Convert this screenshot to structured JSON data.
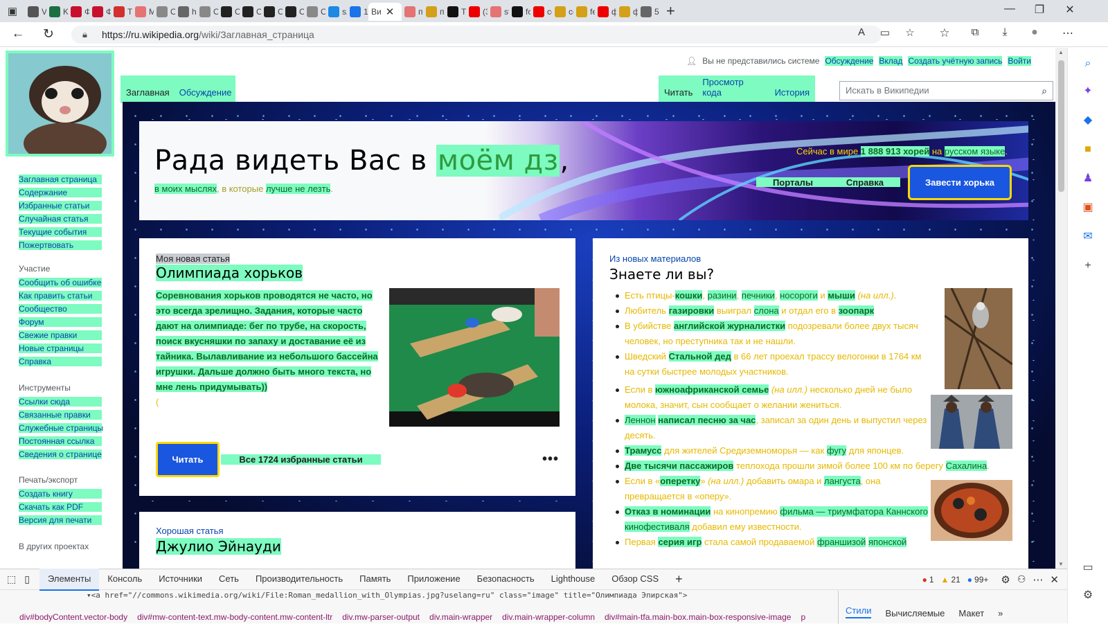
{
  "browser": {
    "tabs": [
      {
        "title": "Vi",
        "color": "#555"
      },
      {
        "title": "Ki",
        "color": "#1d6f42"
      },
      {
        "title": "Ф",
        "color": "#c8102e"
      },
      {
        "title": "Ф",
        "color": "#c8102e"
      },
      {
        "title": "Тс",
        "color": "#d32f2f"
      },
      {
        "title": "М",
        "color": "#e57373"
      },
      {
        "title": "О",
        "color": "#888"
      },
      {
        "title": "h",
        "color": "#666"
      },
      {
        "title": "О",
        "color": "#888"
      },
      {
        "title": "О",
        "color": "#222"
      },
      {
        "title": "О",
        "color": "#222"
      },
      {
        "title": "О",
        "color": "#222"
      },
      {
        "title": "О",
        "color": "#222"
      },
      {
        "title": "О",
        "color": "#888"
      },
      {
        "title": "sz",
        "color": "#1e88e5"
      },
      {
        "title": "1",
        "color": "#1a73e8"
      }
    ],
    "active_tab_title": "Ви",
    "tabs_after": [
      {
        "title": "п",
        "color": "#e57373"
      },
      {
        "title": "п",
        "color": "#d4a017"
      },
      {
        "title": "Те",
        "color": "#111"
      },
      {
        "title": "(3",
        "color": "#e00"
      },
      {
        "title": "st",
        "color": "#e57373"
      },
      {
        "title": "fc",
        "color": "#111"
      },
      {
        "title": "cc",
        "color": "#e00"
      },
      {
        "title": "cc",
        "color": "#d4a017"
      },
      {
        "title": "fe",
        "color": "#d4a017"
      },
      {
        "title": "ф",
        "color": "#e00"
      },
      {
        "title": "ф",
        "color": "#d4a017"
      },
      {
        "title": "5",
        "color": "#666"
      }
    ],
    "url_host": "https://ru.wikipedia.org",
    "url_path": "/wiki/Заглавная_страница"
  },
  "wiki": {
    "personal": {
      "not_logged": "Вы не представились системе",
      "links": [
        "Обсуждение",
        "Вклад",
        "Создать учётную запись",
        "Войти"
      ]
    },
    "left_tabs": [
      "Заглавная",
      "Обсуждение"
    ],
    "right_tabs": [
      "Читать",
      "Просмотр кода",
      "История"
    ],
    "search_placeholder": "Искать в Википедии",
    "sidebar": {
      "nav": [
        "Заглавная страница",
        "Содержание",
        "Избранные статьи",
        "Случайная статья",
        "Текущие события",
        "Пожертвовать"
      ],
      "participation_head": "Участие",
      "participation": [
        "Сообщить об ошибке",
        "Как править статьи",
        "Сообщество",
        "Форум",
        "Свежие правки",
        "Новые страницы",
        "Справка"
      ],
      "tools_head": "Инструменты",
      "tools": [
        "Ссылки сюда",
        "Связанные правки",
        "Служебные страницы",
        "Постоянная ссылка",
        "Сведения о странице"
      ],
      "print_head": "Печать/экспорт",
      "print": [
        "Создать книгу",
        "Скачать как PDF",
        "Версия для печати"
      ],
      "other_head": "В других проектах"
    },
    "banner": {
      "welcome_prefix": "Рада видеть Вас в ",
      "welcome_highlight": "моём дз",
      "welcome_suffix": ",",
      "sub_1": "в моих мыслях",
      "sub_sep": ", ",
      "sub_2": "в которые",
      "sub_3": "лучше не лезть",
      "sub_end": ".",
      "stats_prefix": "Сейчас в мире ",
      "stats_count": "1 888 913 хорей",
      "stats_mid": " на ",
      "stats_lang": "русском языке",
      "stats_end": ".",
      "portals": "Порталы",
      "help": "Справка",
      "create_button": "Завести хорька"
    },
    "featured": {
      "kicker": "Моя новая статья",
      "title": "Олимпиада хорьков",
      "text": "Соревнования хорьков проводятся не часто, но это всегда зрелищно. Задания, которые часто дают на олимпиаде: бег по трубе, на скорость, поиск вкусняшки по запаху и доставание её из тайника. Вылавливание из небольшого бассейна игрушки. Дальше должно быть много текста, но мне лень придумывать))",
      "trailing": "(",
      "read_button": "Читать",
      "all_link": "Все 1724 избранные статьи",
      "more": "•••"
    },
    "dyk": {
      "kicker": "Из новых материалов",
      "title": "Знаете ли вы?"
    },
    "good": {
      "kicker": "Хорошая статья",
      "title": "Джулио Эйнауди"
    }
  },
  "devtools": {
    "tabs": [
      "Элементы",
      "Консоль",
      "Источники",
      "Сеть",
      "Производительность",
      "Память",
      "Приложение",
      "Безопасность",
      "Lighthouse",
      "Обзор CSS"
    ],
    "code_line": "▾<a href=\"//commons.wikimedia.org/wiki/File:Roman_medallion_with_Olympias.jpg?uselang=ru\" class=\"image\" title=\"Олимпиада Эпирская\">",
    "errors": "1",
    "warnings": "21",
    "info": "99+",
    "breadcrumbs": [
      "div#bodyContent.vector-body",
      "div#mw-content-text.mw-body-content.mw-content-ltr",
      "div.mw-parser-output",
      "div.main-wrapper",
      "div.main-wrapper-column",
      "div#main-tfa.main-box.main-box-responsive-image",
      "p"
    ],
    "styles_tabs": [
      "Стили",
      "Вычисляемые",
      "Макет",
      "»"
    ]
  }
}
